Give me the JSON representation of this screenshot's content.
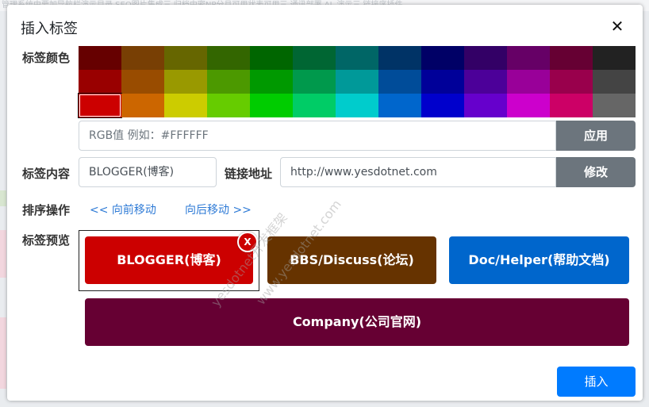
{
  "background": {
    "strip_text": "管理系统中要加导航栏演示目录 SEO图片集成三 归档中密NP分月可用状表可用三 通讯部署 AL 演示三 链接序插件"
  },
  "dialog": {
    "title": "插入标签",
    "close_label": "✕"
  },
  "color_section": {
    "label": "标签颜色",
    "palette": [
      [
        "#660000",
        "#783f04",
        "#666600",
        "#336600",
        "#006600",
        "#006633",
        "#006666",
        "#003366",
        "#000066",
        "#330066",
        "#660066",
        "#660033",
        "#222222"
      ],
      [
        "#990000",
        "#994c00",
        "#999900",
        "#4c9900",
        "#009900",
        "#00994c",
        "#009999",
        "#004c99",
        "#000099",
        "#4c0099",
        "#990099",
        "#99004c",
        "#444444"
      ],
      [
        "#cc0000",
        "#cc6600",
        "#cccc00",
        "#66cc00",
        "#00cc00",
        "#00cc66",
        "#00cccc",
        "#0066cc",
        "#0000cc",
        "#6600cc",
        "#cc00cc",
        "#cc0066",
        "#666666"
      ]
    ],
    "selected": {
      "row": 2,
      "col": 0
    }
  },
  "rgb": {
    "placeholder": "RGB值 例如：#FFFFFF",
    "value": "",
    "apply_label": "应用"
  },
  "content": {
    "label": "标签内容",
    "value": "BLOGGER(博客)",
    "link_label": "链接地址",
    "link_value": "http://www.yesdotnet.com",
    "modify_label": "修改"
  },
  "sort": {
    "label": "排序操作",
    "move_forward": "<< 向前移动",
    "move_backward": "向后移动 >>"
  },
  "preview": {
    "label": "标签预览",
    "close_label": "X",
    "tags": [
      {
        "text": "BLOGGER(博客)",
        "color": "#cc0000"
      },
      {
        "text": "BBS/Discuss(论坛)",
        "color": "#663300"
      },
      {
        "text": "Doc/Helper(帮助文档)",
        "color": "#0066cc"
      },
      {
        "text": "Company(公司官网)",
        "color": "#660033"
      }
    ]
  },
  "footer": {
    "insert_label": "插入"
  },
  "watermark": {
    "line1": "yesdotnet开发框架",
    "line2": "www.yesdotnet.com"
  }
}
